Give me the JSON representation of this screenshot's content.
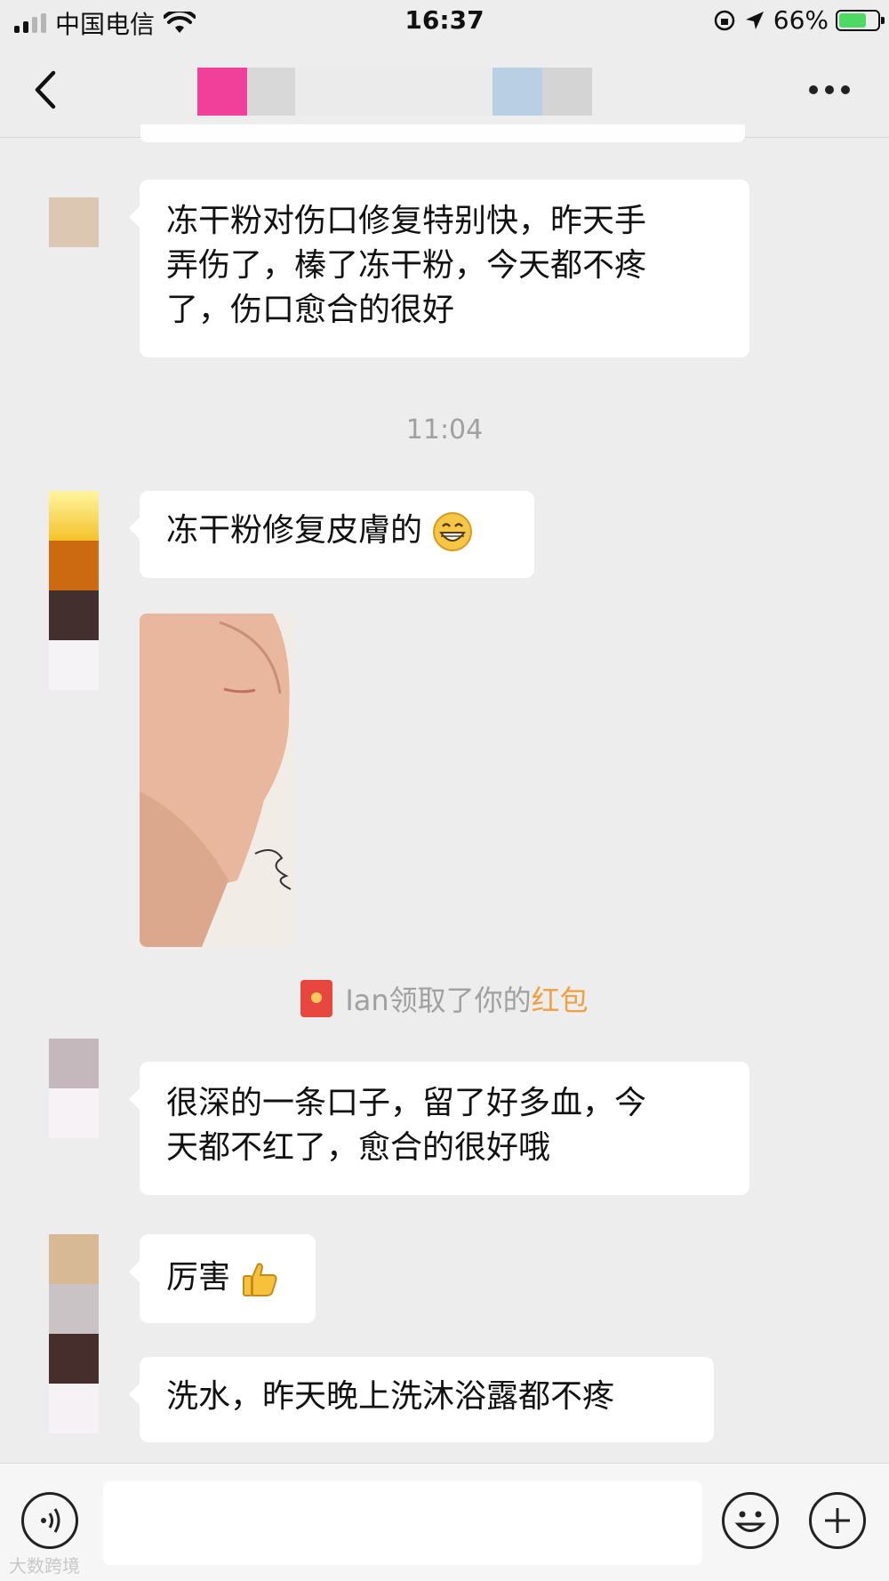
{
  "status_bar": {
    "carrier": "中国电信",
    "time": "16:37",
    "battery_percent": "66%"
  },
  "nav": {
    "back_icon": "chevron-left-icon",
    "more_icon": "more-dots-icon"
  },
  "messages": [
    {
      "type": "text",
      "text": "冻干粉对伤口修复特别快，昨天手弄伤了，�澿了冻干粉，今天都不疼了，伤口愈合的很好"
    },
    {
      "type": "time",
      "text": "11:04"
    },
    {
      "type": "text",
      "text": "冻干粉修复皮膚的",
      "emoji": "grin-emoji"
    },
    {
      "type": "image",
      "description": "hand-photo"
    },
    {
      "type": "system",
      "prefix": "Ian领取了你的",
      "highlight": "红包"
    },
    {
      "type": "text",
      "text": "很深的一条口子，留了好多血，今天都不红了，愈合的很好哦"
    },
    {
      "type": "text",
      "text": "厉害",
      "emoji": "thumbs-up-emoji"
    },
    {
      "type": "text",
      "text": "洗水，昨天晚上洗沐浴露都不疼"
    }
  ],
  "message_lines": {
    "m1": [
      "冻干粉对伤口修复特别快，昨天手",
      "弄伤了，榛了冻干粉，今天都不疼",
      "了，伤口愈合的很好"
    ],
    "m5": [
      "很深的一条口子，留了好多血，今",
      "天都不红了，愈合的很好哦"
    ]
  },
  "input_bar": {
    "voice_icon": "voice-icon",
    "emoji_icon": "emoji-icon",
    "plus_icon": "plus-icon"
  },
  "watermark": "大数跨境",
  "colors": {
    "background": "#ededed",
    "bubble": "#ffffff",
    "time_text": "#a0a0a0",
    "red_packet_highlight": "#f0a040",
    "battery_fill": "#4cd964"
  }
}
